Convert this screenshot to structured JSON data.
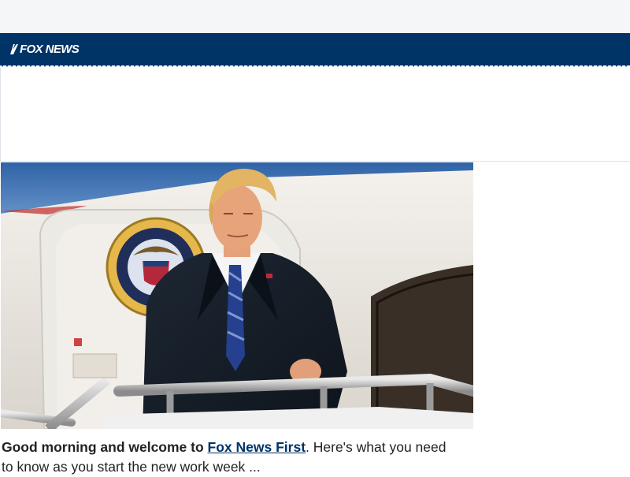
{
  "header": {
    "logo_text": "FOX NEWS",
    "brand_color": "#003366"
  },
  "hero": {
    "image_description_icon": "president-photo",
    "seal_text": "SEAL OF THE PRESIDENT OF THE UNITED STATES"
  },
  "article": {
    "intro_bold": "Good morning and welcome to ",
    "intro_link": "Fox News First",
    "intro_rest_first": ". Here's what you need",
    "intro_rest_second": "to know as you start the new work week ..."
  }
}
